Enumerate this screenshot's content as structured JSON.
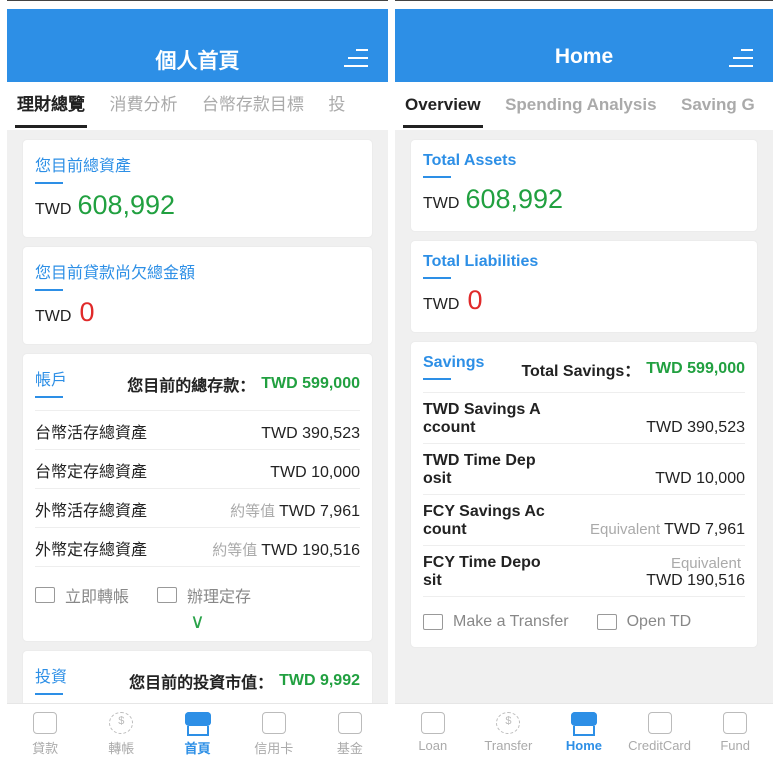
{
  "left": {
    "header_title": "個人首頁",
    "tabs": [
      "理財總覽",
      "消費分析",
      "台幣存款目標",
      "投"
    ],
    "assets": {
      "label": "您目前總資產",
      "currency": "TWD",
      "value": "608,992"
    },
    "liabilities": {
      "label": "您目前貸款尚欠總金額",
      "currency": "TWD",
      "value": "0"
    },
    "accounts": {
      "label": "帳戶",
      "total_label": "您目前的總存款：",
      "total_value": "TWD 599,000",
      "rows": [
        {
          "name": "台幣活存總資產",
          "eq": "",
          "value": "TWD 390,523"
        },
        {
          "name": "台幣定存總資產",
          "eq": "",
          "value": "TWD 10,000"
        },
        {
          "name": "外幣活存總資產",
          "eq": "約等值",
          "value": "TWD 7,961"
        },
        {
          "name": "外幣定存總資產",
          "eq": "約等值",
          "value": "TWD 190,516"
        }
      ],
      "action_transfer": "立即轉帳",
      "action_td": "辦理定存",
      "expand_icon": "chevron-down-icon"
    },
    "invest": {
      "label": "投資",
      "total_label": "您目前的投資市值：",
      "total_value": "TWD 9,992"
    },
    "nav": [
      "貸款",
      "轉帳",
      "首頁",
      "信用卡",
      "基金"
    ]
  },
  "right": {
    "header_title": "Home",
    "tabs": [
      "Overview",
      "Spending Analysis",
      "Saving G"
    ],
    "assets": {
      "label": "Total Assets",
      "currency": "TWD",
      "value": "608,992"
    },
    "liabilities": {
      "label": "Total Liabilities",
      "currency": "TWD",
      "value": "0"
    },
    "accounts": {
      "label": "Savings",
      "total_label": "Total Savings：",
      "total_value": "TWD 599,000",
      "rows": [
        {
          "name1": "TWD Savings A",
          "name2": "ccount",
          "eq": "",
          "value": "TWD 390,523"
        },
        {
          "name1": "TWD Time Dep",
          "name2": "osit",
          "eq": "",
          "value": "TWD 10,000"
        },
        {
          "name1": "FCY Savings Ac",
          "name2": "count",
          "eq": "Equivalent",
          "value": "TWD 7,961"
        },
        {
          "name1": "FCY Time Depo",
          "name2": "sit",
          "eq": "Equivalent",
          "value": "TWD 190,516"
        }
      ],
      "action_transfer": "Make a Transfer",
      "action_td": "Open TD"
    },
    "nav": [
      "Loan",
      "Transfer",
      "Home",
      "CreditCard",
      "Fund"
    ]
  },
  "colors": {
    "primary": "#2d8fe6",
    "positive": "#21a040",
    "negative": "#e02a2a"
  }
}
